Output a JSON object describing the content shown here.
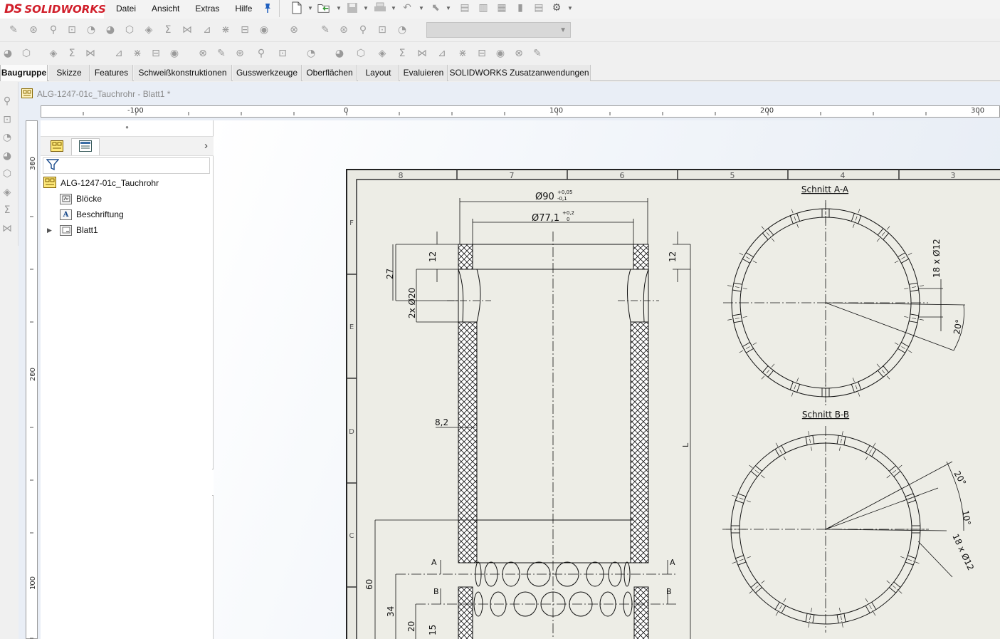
{
  "app": {
    "brand_prefix": "DS",
    "brand_name": "SOLIDWORKS"
  },
  "menu": [
    "Datei",
    "Ansicht",
    "Extras",
    "Hilfe"
  ],
  "ribbon_tabs": [
    "Baugruppe",
    "Skizze",
    "Features",
    "Schweißkonstruktionen",
    "Gusswerkzeuge",
    "Oberflächen",
    "Layout",
    "Evaluieren",
    "SOLIDWORKS Zusatzanwendungen"
  ],
  "active_tab": "Baugruppe",
  "document": {
    "title": "ALG-1247-01c_Tauchrohr - Blatt1 *"
  },
  "rulers": {
    "horizontal": [
      "-100",
      "0",
      "100",
      "200",
      "300"
    ],
    "vertical": [
      "300",
      "200",
      "100"
    ]
  },
  "feature_tree": {
    "root": "ALG-1247-01c_Tauchrohr",
    "items": [
      "Blöcke",
      "Beschriftung",
      "Blatt1"
    ]
  },
  "drawing": {
    "zone_numbers": [
      "8",
      "7",
      "6",
      "5",
      "4",
      "3"
    ],
    "zone_letters": [
      "F",
      "E",
      "D",
      "C"
    ],
    "section_aa": "Schnitt A-A",
    "section_bb": "Schnitt B-B",
    "dims": {
      "d90": "Ø90",
      "d90_tol_up": "+0,05",
      "d90_tol_dn": "-0,1",
      "d77": "Ø77,1",
      "d77_tol_up": "+0,2",
      "d77_tol_dn": "0",
      "h12_left": "12",
      "h12_right": "12",
      "h27": "27",
      "holes20": "2x Ø20",
      "wall": "8,2",
      "h60": "60",
      "h34": "34",
      "h20": "20",
      "h15": "15",
      "L": "L",
      "holes12_a": "18 x Ø12",
      "ang20_a": "20°",
      "ang20_b": "20°",
      "ang10_b": "10°",
      "holes12_b": "18 x Ø12",
      "cut_a": "A",
      "cut_b": "B"
    }
  }
}
